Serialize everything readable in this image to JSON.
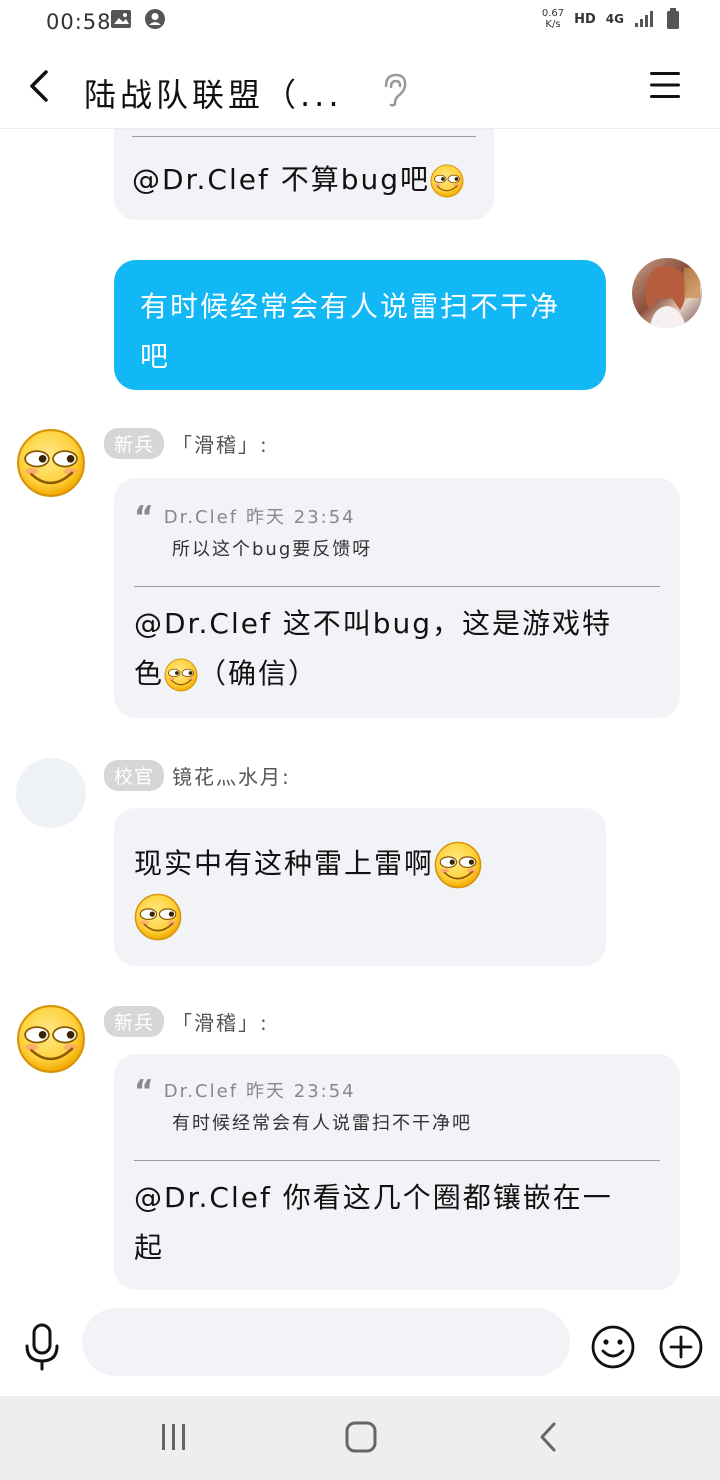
{
  "status_bar": {
    "time": "00:58",
    "net_speed_value": "0.67",
    "net_speed_unit": "K/s",
    "hd": "HD",
    "network": "4G"
  },
  "header": {
    "title": "陆战队联盟（..."
  },
  "messages": [
    {
      "type": "partial_reply",
      "reply_text": "@Dr.Clef 不算bug吧"
    },
    {
      "type": "self",
      "text": "有时候经常会有人说雷扫不干净吧"
    },
    {
      "type": "reply",
      "rank": "新兵",
      "sender": "「滑稽」:",
      "quote_author": "Dr.Clef",
      "quote_time": "昨天 23:54",
      "quote_text": "所以这个bug要反馈呀",
      "reply_prefix": "@Dr.Clef 这不叫bug，这是游戏特",
      "reply_mid": "色",
      "reply_suffix": "（确信）"
    },
    {
      "type": "text",
      "rank": "校官",
      "sender": "镜花灬水月:",
      "text": "现实中有这种雷上雷啊"
    },
    {
      "type": "reply",
      "rank": "新兵",
      "sender": "「滑稽」:",
      "quote_author": "Dr.Clef",
      "quote_time": "昨天 23:54",
      "quote_text": "有时候经常会有人说雷扫不干净吧",
      "reply_text": "@Dr.Clef 你看这几个圈都镶嵌在一起"
    }
  ],
  "input": {
    "placeholder": ""
  },
  "icons": {
    "back": "back-arrow-icon",
    "ear": "ear-icon",
    "menu": "hamburger-menu-icon",
    "mic": "microphone-icon",
    "emoji": "smiley-icon",
    "plus": "plus-icon",
    "emoji_in_text": "huaji-smirk-emoji"
  },
  "colors": {
    "self_bubble": "#12b7f5",
    "other_bubble": "#f1f3f7",
    "rank_badge": "#d6d6d6",
    "nav_bar": "#eeeeee"
  }
}
